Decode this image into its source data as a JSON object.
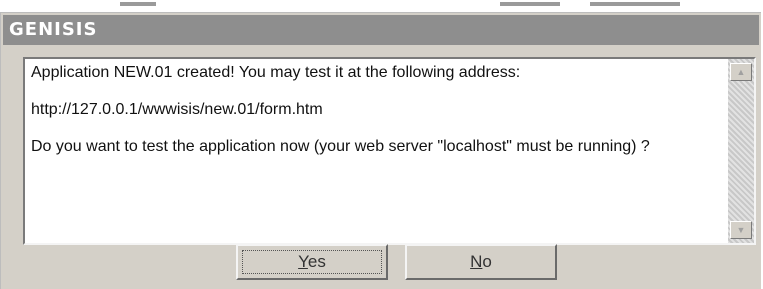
{
  "window": {
    "title": "GENISIS"
  },
  "message": {
    "line1": "Application NEW.01 created! You may test it at the following address:",
    "line2": "http://127.0.0.1/wwwisis/new.01/form.htm",
    "line3": "Do you want to test the application now (your web server \"localhost\" must be running) ?"
  },
  "buttons": {
    "yes_mnemonic": "Y",
    "yes_rest": "es",
    "no_mnemonic": "N",
    "no_rest": "o"
  },
  "scrollbar": {
    "up_icon": "arrow-up-icon",
    "down_icon": "arrow-down-icon"
  }
}
